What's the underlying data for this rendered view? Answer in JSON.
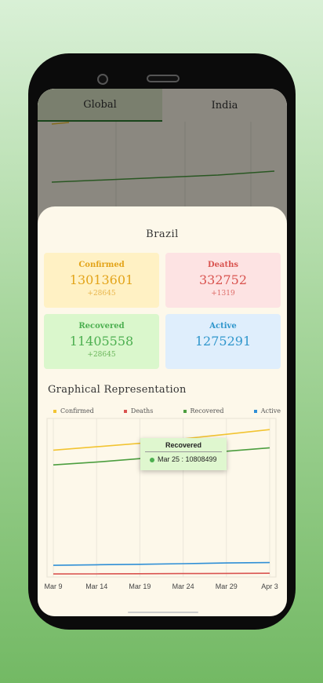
{
  "tabs": [
    {
      "label": "Global",
      "active": true
    },
    {
      "label": "India",
      "active": false
    }
  ],
  "country": "Brazil",
  "stats": {
    "confirmed": {
      "label": "Confirmed",
      "value": "13013601",
      "delta": "+28645"
    },
    "deaths": {
      "label": "Deaths",
      "value": "332752",
      "delta": "+1319"
    },
    "recovered": {
      "label": "Recovered",
      "value": "11405558",
      "delta": "+28645"
    },
    "active": {
      "label": "Active",
      "value": "1275291"
    }
  },
  "graph_title": "Graphical Representation",
  "tooltip": {
    "title": "Recovered",
    "text": "Mar 25 : 10808499"
  },
  "colors": {
    "confirmed": "#f2c432",
    "deaths": "#d9534f",
    "recovered": "#4c9e3f",
    "active": "#2f8fd6"
  },
  "chart_data": {
    "type": "line",
    "x": [
      "Mar 9",
      "Mar 14",
      "Mar 19",
      "Mar 24",
      "Mar 29",
      "Apr 3"
    ],
    "series": [
      {
        "name": "Confirmed",
        "values": [
          11200000,
          11500000,
          11800000,
          12200000,
          12600000,
          13013601
        ]
      },
      {
        "name": "Deaths",
        "values": [
          268000,
          278000,
          290000,
          303000,
          318000,
          332752
        ]
      },
      {
        "name": "Recovered",
        "values": [
          9900000,
          10150000,
          10450000,
          10800000,
          11100000,
          11405558
        ]
      },
      {
        "name": "Active",
        "values": [
          1030000,
          1080000,
          1120000,
          1180000,
          1240000,
          1275291
        ]
      }
    ],
    "ylim": [
      0,
      14000000
    ],
    "grid": true,
    "legend": "top"
  }
}
